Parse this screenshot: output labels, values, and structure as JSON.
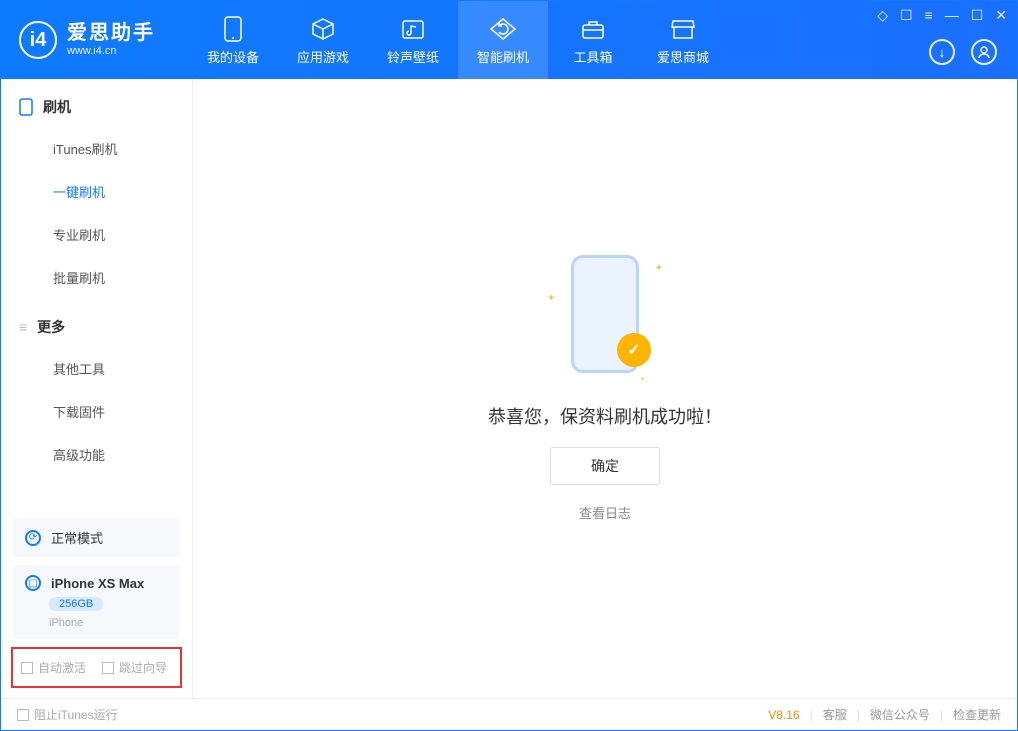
{
  "app": {
    "title": "爱思助手",
    "subtitle": "www.i4.cn"
  },
  "tabs": {
    "device": "我的设备",
    "apps": "应用游戏",
    "ringtones": "铃声壁纸",
    "flash": "智能刷机",
    "toolbox": "工具箱",
    "store": "爱思商城"
  },
  "sidebar": {
    "section_flash": "刷机",
    "items_flash": {
      "itunes": "iTunes刷机",
      "onekey": "一键刷机",
      "pro": "专业刷机",
      "batch": "批量刷机"
    },
    "section_more": "更多",
    "items_more": {
      "other": "其他工具",
      "firmware": "下载固件",
      "advanced": "高级功能"
    }
  },
  "device": {
    "mode": "正常模式",
    "name": "iPhone XS Max",
    "storage": "256GB",
    "type": "iPhone"
  },
  "checks": {
    "auto_activate": "自动激活",
    "skip_guide": "跳过向导"
  },
  "main": {
    "success": "恭喜您，保资料刷机成功啦！",
    "ok": "确定",
    "view_log": "查看日志"
  },
  "footer": {
    "block_itunes": "阻止iTunes运行",
    "version": "V8.16",
    "support": "客服",
    "wechat": "微信公众号",
    "update": "检查更新"
  }
}
